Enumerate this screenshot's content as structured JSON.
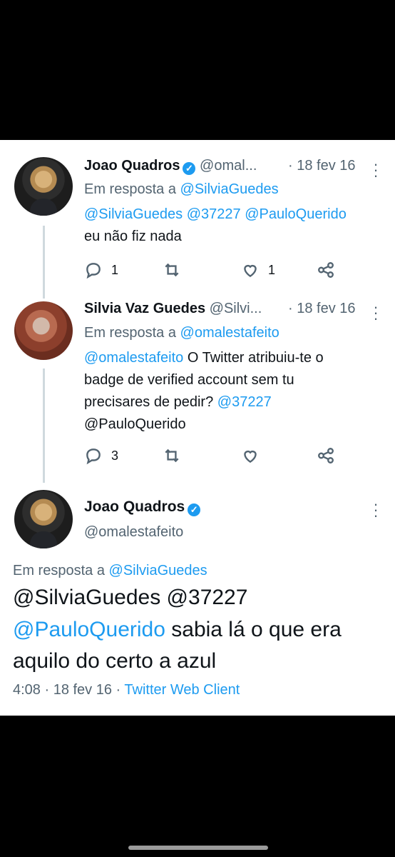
{
  "tweets": [
    {
      "name": "Joao Quadros",
      "handle": "@omal...",
      "date": "· 18 fev 16",
      "reply_prefix": "Em resposta a",
      "reply_to": "@SilviaGuedes",
      "text_lines": [
        [
          "@SilviaGuedes",
          " ",
          "@37227",
          " ",
          "@PauloQuerido"
        ],
        [
          "eu não fiz nada"
        ]
      ],
      "reply_count": "1",
      "retweet_count": "",
      "like_count": "1"
    },
    {
      "name": "Silvia Vaz Guedes",
      "handle": "@Silvi...",
      "date": "· 18 fev 16",
      "reply_prefix": "Em resposta a",
      "reply_to": "@omalestafeito",
      "text_lines": [
        [
          "@omalestafeito",
          " O Twitter atribuiu-te o"
        ],
        [
          "badge de verified account sem tu"
        ],
        [
          "precisares de pedir? ",
          "@37227"
        ],
        [
          "@PauloQuerido"
        ]
      ],
      "reply_count": "3",
      "retweet_count": "",
      "like_count": ""
    }
  ],
  "main_tweet": {
    "name": "Joao Quadros",
    "handle": "@omalestafeito",
    "reply_prefix": "Em resposta a",
    "reply_to": "@SilviaGuedes",
    "line1": "@SilviaGuedes @37227",
    "line2_mention": "@PauloQuerido",
    "line2_text": " sabia lá o que era",
    "line3": "aquilo do certo a azul",
    "time_date": "4:08 · 18 fev 16 · ",
    "client": "Twitter Web Client"
  },
  "icons": [
    "verified-icon",
    "reply-icon",
    "retweet-icon",
    "like-icon",
    "share-icon",
    "more-icon"
  ],
  "colors": {
    "blue": "#1d9bf0",
    "muted": "#536471",
    "text": "#0f1419",
    "background": "#ffffff"
  }
}
